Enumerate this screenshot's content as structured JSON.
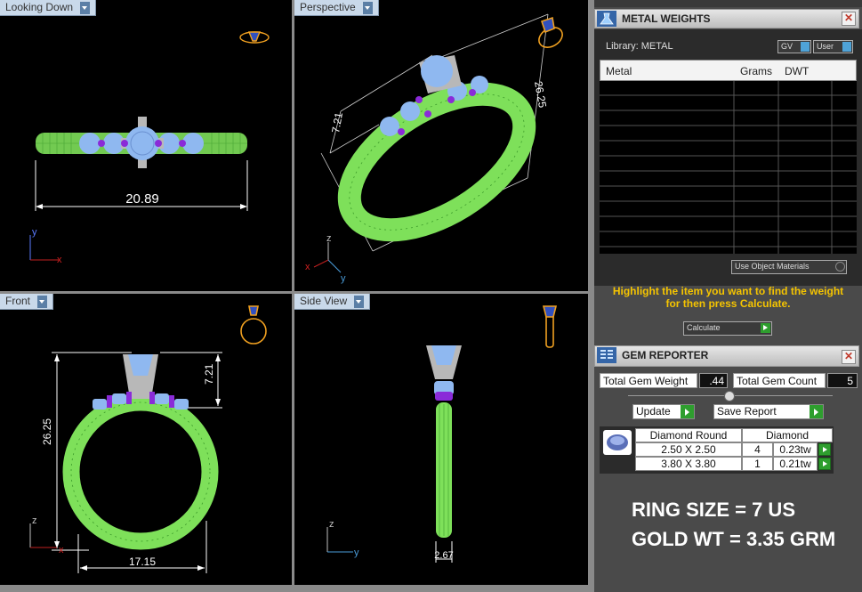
{
  "viewports": {
    "looking_down": {
      "label": "Looking Down",
      "dimension": "20.89"
    },
    "perspective": {
      "label": "Perspective",
      "dim_left": "7.21",
      "dim_right": "26.25"
    },
    "front": {
      "label": "Front",
      "dim_height": "26.25",
      "dim_top": "7.21",
      "dim_width": "17.15"
    },
    "side_view": {
      "label": "Side View",
      "dim_width": "2.67"
    }
  },
  "axes": {
    "x": "x",
    "y": "y",
    "z": "z"
  },
  "metal_weights": {
    "title": "METAL WEIGHTS",
    "library_label": "Library: METAL",
    "gv_label": "GV",
    "user_label": "User",
    "columns": [
      "Metal",
      "Grams",
      "DWT"
    ],
    "use_object_materials": "Use Object Materials",
    "instruction": "Highlight the item you want to find the weight for then press Calculate.",
    "calculate_label": "Calculate"
  },
  "gem_reporter": {
    "title": "GEM REPORTER",
    "total_weight_label": "Total Gem Weight",
    "total_weight_value": ".44",
    "total_count_label": "Total Gem Count",
    "total_count_value": "5",
    "update_label": "Update",
    "save_report_label": "Save Report",
    "table_headers": [
      "Diamond Round",
      "Diamond"
    ],
    "rows": [
      {
        "size": "2.50 X 2.50",
        "count": "4",
        "weight": "0.23tw"
      },
      {
        "size": "3.80 X 3.80",
        "count": "1",
        "weight": "0.21tw"
      }
    ]
  },
  "summary": {
    "ring_size": "RING SIZE = 7 US",
    "gold_weight": "GOLD WT = 3.35 GRM"
  },
  "colors": {
    "ring_green": "#7ee05a",
    "gem_blue": "#8fb8f0",
    "prong_purple": "#8a2bd8",
    "accent_orange": "#f0a020",
    "instruction_yellow": "#f5c400"
  }
}
